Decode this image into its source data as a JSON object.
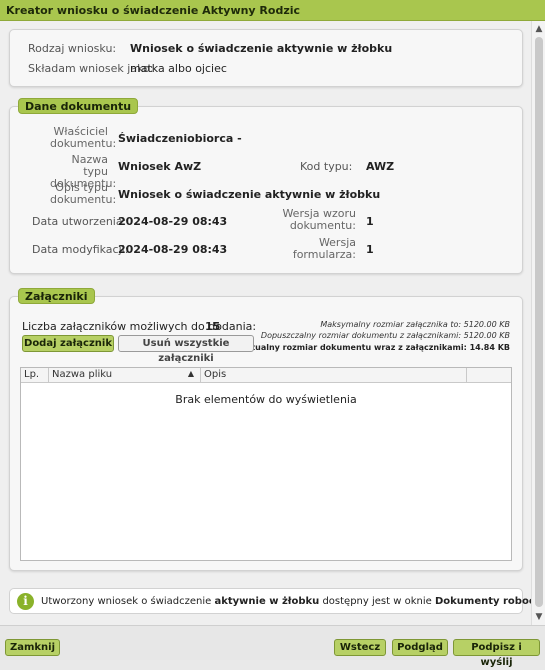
{
  "window": {
    "title": "Kreator wniosku o świadczenie Aktywny Rodzic"
  },
  "summary": {
    "type_label": "Rodzaj wniosku:",
    "type_value": "Wniosek o świadczenie aktywnie w żłobku",
    "as_label": "Składam wniosek jako:",
    "as_value": "matka albo ojciec"
  },
  "document": {
    "section_title": "Dane dokumentu",
    "owner_label": "Właściciel dokumentu:",
    "owner_value": "Świadczeniobiorca -",
    "type_name_label": "Nazwa typu dokumentu:",
    "type_name_value": "Wniosek AwZ",
    "type_code_label": "Kod typu:",
    "type_code_value": "AWZ",
    "type_desc_label": "Opis typu dokumentu:",
    "type_desc_value": "Wniosek o świadczenie aktywnie w żłobku",
    "created_label": "Data utworzenia:",
    "created_value": "2024-08-29 08:43",
    "template_version_label": "Wersja wzoru dokumentu:",
    "template_version_value": "1",
    "modified_label": "Data modyfikacji:",
    "modified_value": "2024-08-29 08:43",
    "form_version_label": "Wersja formularza:",
    "form_version_value": "1"
  },
  "attachments": {
    "section_title": "Załączniki",
    "count_label": "Liczba załączników możliwych do dodania:",
    "count_value": "15",
    "max_size_text": "Maksymalny rozmiar załącznika to: 5120.00 KB",
    "allowed_size_text": "Dopuszczalny rozmiar dokumentu z załącznikami: 5120.00 KB",
    "current_size_text": "Aktualny rozmiar dokumentu wraz z załącznikami: 14.84 KB",
    "add_button": "Dodaj załącznik",
    "remove_all_button": "Usuń wszystkie załączniki",
    "columns": [
      "Lp.",
      "Nazwa pliku",
      "Opis",
      ""
    ],
    "sort_indicator": "▲",
    "empty_text": "Brak elementów do wyświetlenia"
  },
  "info": {
    "icon": "info-icon",
    "text_before": "Utworzony wniosek o świadczenie ",
    "text_bold1": "aktywnie w żłobku",
    "text_middle": " dostępny jest w oknie ",
    "text_bold2": "Dokumenty robocze",
    "text_end": "."
  },
  "footer": {
    "close_button": "Zamknij",
    "back_button": "Wstecz",
    "preview_button": "Podgląd",
    "sign_send_button": "Podpisz i wyślij"
  },
  "colors": {
    "accent": "#a9c64e",
    "button_green": "#b7d065"
  }
}
